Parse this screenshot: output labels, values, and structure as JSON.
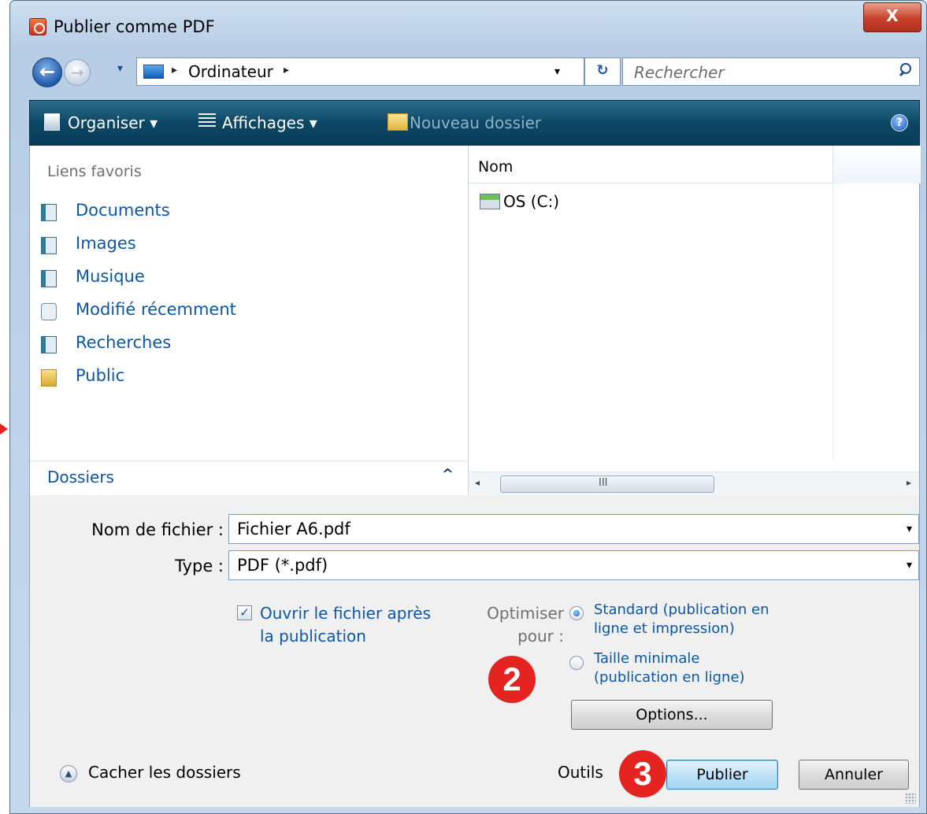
{
  "window": {
    "title": "Publier comme PDF",
    "close_symbol": "X",
    "app_icon": "pdf-publisher-icon"
  },
  "navigation": {
    "back_symbol": "←",
    "forward_symbol": "→",
    "history_dropdown_symbol": "▾",
    "address": {
      "separator": "▸",
      "crumb": "Ordinateur",
      "dropdown_symbol": "▾"
    },
    "refresh_symbol": "↻",
    "search": {
      "placeholder": "Rechercher",
      "icon": "search-icon"
    }
  },
  "toolbar": {
    "organise": "Organiser ▾",
    "views": "Affichages ▾",
    "new_folder": "Nouveau dossier",
    "help_symbol": "?"
  },
  "favorites": {
    "header": "Liens favoris",
    "items": [
      {
        "label": "Documents",
        "icon": "documents-icon"
      },
      {
        "label": "Images",
        "icon": "images-icon"
      },
      {
        "label": "Musique",
        "icon": "music-icon"
      },
      {
        "label": "Modifié récemment",
        "icon": "recent-icon"
      },
      {
        "label": "Recherches",
        "icon": "searches-icon"
      },
      {
        "label": "Public",
        "icon": "public-folder-icon"
      }
    ],
    "folders_label": "Dossiers",
    "folders_caret": "^"
  },
  "file_list": {
    "column_name": "Nom",
    "items": [
      {
        "label": "OS (C:)",
        "icon": "drive-icon"
      }
    ],
    "scroll_left": "◂",
    "scroll_right": "▸",
    "scroll_grip": "III"
  },
  "form": {
    "filename_label": "Nom de fichier :",
    "filename_value": "Fichier A6.pdf",
    "type_label": "Type :",
    "type_value": "PDF (*.pdf)",
    "combo_arrow": "▾"
  },
  "options": {
    "open_after_checked": true,
    "check_mark": "✓",
    "open_after_label_line1": "Ouvrir le fichier après",
    "open_after_label_line2": "la publication",
    "optimize_label_line1": "Optimiser",
    "optimize_label_line2": "pour :",
    "radio_standard_line1": "Standard (publication en",
    "radio_standard_line2": "ligne et impression)",
    "radio_minimal_line1": "Taille minimale",
    "radio_minimal_line2": "(publication en ligne)",
    "selected": "standard",
    "options_button": "Options..."
  },
  "footer": {
    "hide_folders_symbol": "▲",
    "hide_folders": "Cacher les dossiers",
    "tools": "Outils",
    "publish": "Publier",
    "cancel": "Annuler"
  },
  "callouts": {
    "badge_2": "2",
    "badge_3": "3",
    "color": "#e52421"
  }
}
